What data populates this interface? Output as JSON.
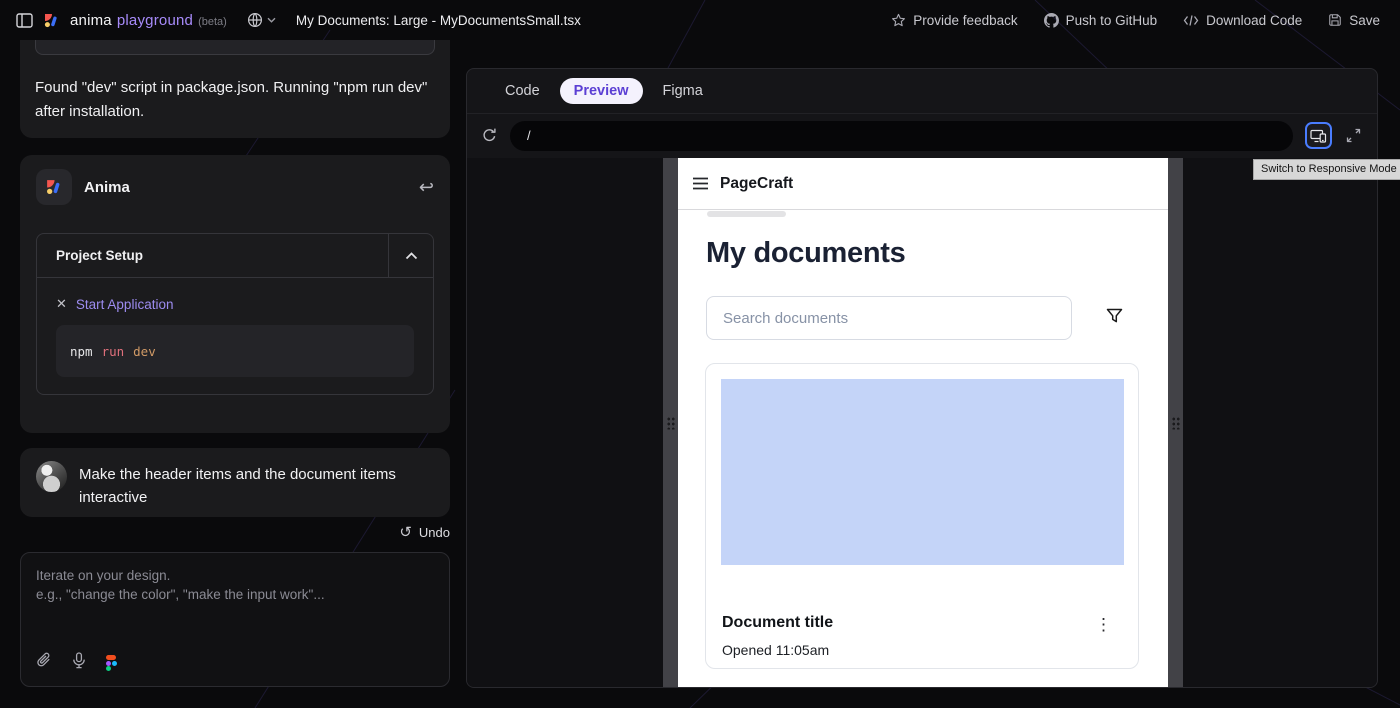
{
  "topbar": {
    "brand_primary": "anima",
    "brand_secondary": "playground",
    "beta_tag": "(beta)",
    "document_title": "My Documents: Large - MyDocumentsSmall.tsx",
    "actions": {
      "feedback": "Provide feedback",
      "github": "Push to GitHub",
      "download": "Download Code",
      "save": "Save"
    }
  },
  "sidebar": {
    "system_message": "Found \"dev\" script in package.json. Running \"npm run dev\" after installation.",
    "anima_card": {
      "title": "Anima",
      "project_setup": {
        "title": "Project Setup",
        "step_label": "Start Application",
        "command_npm": "npm",
        "command_run": "run",
        "command_dev": "dev"
      }
    },
    "user_message": "Make the header items and the document items interactive",
    "undo_label": "Undo",
    "composer": {
      "placeholder_line1": "Iterate on your design.",
      "placeholder_line2": "e.g., \"change the color\", \"make the input work\"..."
    }
  },
  "preview_panel": {
    "tabs": [
      {
        "label": "Code"
      },
      {
        "label": "Preview"
      },
      {
        "label": "Figma"
      }
    ],
    "url_value": "/",
    "tooltip": "Switch to Responsive Mode",
    "app": {
      "name": "PageCraft",
      "heading": "My documents",
      "search_placeholder": "Search documents",
      "document_title": "Document title",
      "document_meta": "Opened 11:05am"
    }
  },
  "colors": {
    "accent_purple": "#a78bfa",
    "tab_active_text": "#5b3fd4",
    "focus_ring_blue": "#4a7dff",
    "thumb_blue": "#c4d4f8",
    "step_link_purple": "#9d8cf0"
  }
}
